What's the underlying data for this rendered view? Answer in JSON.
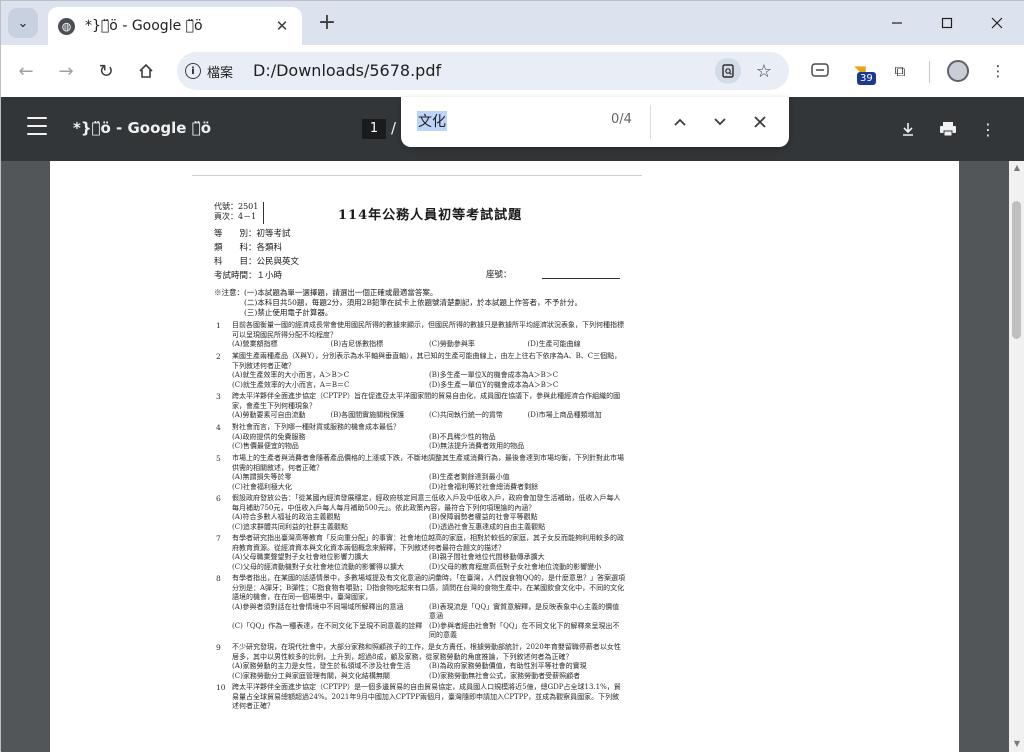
{
  "tab": {
    "title": "*}ㄏ̈ö - Google ㄏ̈ö"
  },
  "toolbar": {
    "info_label": "檔案",
    "url": "D:/Downloads/5678.pdf",
    "extension_badge": "39"
  },
  "pdf": {
    "title": "*}ㄏ̈ö - Google ㄏ̈ö",
    "page_input": "1",
    "page_sep": "/"
  },
  "find": {
    "query": "文化",
    "count": "0/4"
  },
  "exam": {
    "code_line1": "代號：2501",
    "code_line2": "頁次：4－1",
    "title": "114年公務人員初等考試試題",
    "meta": [
      "等　　別：初等考試",
      "類　　科：各類科",
      "科　　目：公民與英文",
      "考試時間：１小時"
    ],
    "seat_label": "座號：",
    "notice": [
      "※注意：(一)本試題為單一選擇題，請選出一個正確或最適當答案。",
      "　　　　(二)本科目共50題，每題2分，須用2B鉛筆在試卡上依題號清楚劃記，於本試題上作答者，不予計分。",
      "　　　　(三)禁止使用電子計算器。"
    ],
    "questions": [
      {
        "num": "1",
        "body": "目前各國衡量一國的經濟成長常會使用國民所得的數據來顯示，但國民所得的數據只是數據所平均經濟狀況表象，下列何種指標可以呈現國民所得分配不均程度？",
        "opts": [
          "(A)營業額指標",
          "(B)吉尼係數指標",
          "(C)勞動參與率",
          "(D)生產可能曲線"
        ],
        "four": true
      },
      {
        "num": "2",
        "body": "某國生產兩種產品（X與Y），分別表示為水平軸與垂直軸），其已知的生產可能曲線上，由左上往右下依序為A、B、C三個點，下列敘述何者正確？",
        "opts": [
          "(A)就生產效率的大小而言，A＞B＞C",
          "(B)多生產一單位X的機會成本為A＞B＞C",
          "(C)就生產效率的大小而言，A＝B＝C",
          "(D)多生產一單位Y的機會成本為A＞B＞C"
        ],
        "four": false
      },
      {
        "num": "3",
        "body": "跨太平洋夥伴全面進步協定（CPTPP）旨在促進亞太平洋國家間的貿易自由化，成員國在協議下，參與此種經濟合作組織的國家，會產生下列何種現象？",
        "opts": [
          "(A)勞動要素可自由流動",
          "(B)各國間實施關稅保護",
          "(C)共同執行統一的貨幣",
          "(D)市場上商品種類增加"
        ],
        "four": true
      },
      {
        "num": "4",
        "body": "對社會而言，下列哪一種財貨或服務的機會成本最低？",
        "opts": [
          "(A)政府提供的免費服務",
          "(B)不具稀少性的物品",
          "(C)售價最便宜的物品",
          "(D)無法提升消費者效用的物品"
        ],
        "four": false
      },
      {
        "num": "5",
        "body": "市場上的生產者與消費者會隨著產品價格的上漲或下跌，不斷地調整其生產或消費行為，最後會達到市場均衡，下列針對此市場供需的相關敘述，何者正確？",
        "opts": [
          "(A)無謂損失等於零",
          "(B)生產者剩餘達到最小值",
          "(C)社會福利極大化",
          "(D)社會福利等於社會總消費者剩餘"
        ],
        "four": false
      },
      {
        "num": "6",
        "body": "假設政府發放公告：「從某國內經濟發展穩定，經政府核定同意三低收入戶及中低收入戶，政府會加發生活補助，低收入戶每人每月補助750元，中低收入戶每人每月補助500元」。依此政策內容，最符合下列何項理論的內涵？",
        "opts": [
          "(A)符合多數人福祉的政治主義觀點",
          "(B)保障弱勢者權益的社會平等觀點",
          "(C)追求群體共同利益的社群主義觀點",
          "(D)透過社會互惠達成的自由主義觀點"
        ],
        "four": false
      },
      {
        "num": "7",
        "body": "有學者研究指出臺灣高等教育「反向重分配」的事實：社會地位越高的家庭，相對於較低的家庭，其子女反而能夠利用較多的政府教育資源。從經濟資本與文化資本兩個概念來解釋，下列敘述何者最符合題文的描述？",
        "opts": [
          "(A)父母職業聲望對子女社會地位影響力擴大",
          "(B)親子間社會地位代間移動傳承擴大",
          "(C)父母的經濟動機對子女社會地位流動的影響得以擴大",
          "(D)父母的教育程度高低對子女社會地位流動的影響變小"
        ],
        "four": false
      },
      {
        "num": "8",
        "body": "有學者指出，在某國的話語情景中，多數場域提及有文化意涵的詞彙時，「在臺灣，人們說食物QQ的，是什麼意思？」答案選項分別是：A彈牙；B彈性；C指食物有嚼勁；D指食物吃起來有口感，請問在台灣的食物生產中，在某國飲食文化中，不同的文化語境的機會，在在同一個場景中，臺灣國家，",
        "opts": [
          "(A)參與者須對話在社會情境中不同場域所解釋出的意涵",
          "(B)表現流是「QQ」實質意解釋，是反映表象中心主義的價值意涵",
          "(C)「QQ」作為一種表達，在不同文化下呈現不同意義的詮釋",
          "(D)參與者經由社會對「QQ」在不同文化下的解釋來呈現出不同的意義"
        ],
        "four": false
      },
      {
        "num": "9",
        "body": "不少研究發現，在現代社會中，大部分家務和照顧孩子的工作，是女方責任，根據勞動部統計，2020年育嬰留職停薪者以女性居多，其中以男性較多的比例，上升到，超過8成，顧及家務，從家務勞動的角度推論，下列敘述何者為正確？",
        "opts": [
          "(A)家務勞動的主力是女性，發生於私領域不涉及社會生活",
          "(B)為政府家務勞動價值，有助性別平等社會的實現",
          "(C)家務勞動分工與家庭管理有關，與文化結構無關",
          "(D)家務勞動無社會公式，家務勞動者受薪照顧者"
        ],
        "four": false
      },
      {
        "num": "10",
        "body": "跨太平洋夥伴全面進步協定（CPTPP）是一個多邊貿易的自由貿易協定，成員國人口規模將近5億，總GDP占全球13.1%，貿易量占全球貿易總額超過24%。2021年9月中國加入CPTPP兩個月，臺灣隨即申請加入CPTPP，並成為觀察員國家。下列敘述何者正確？",
        "opts": [],
        "four": false
      }
    ]
  }
}
